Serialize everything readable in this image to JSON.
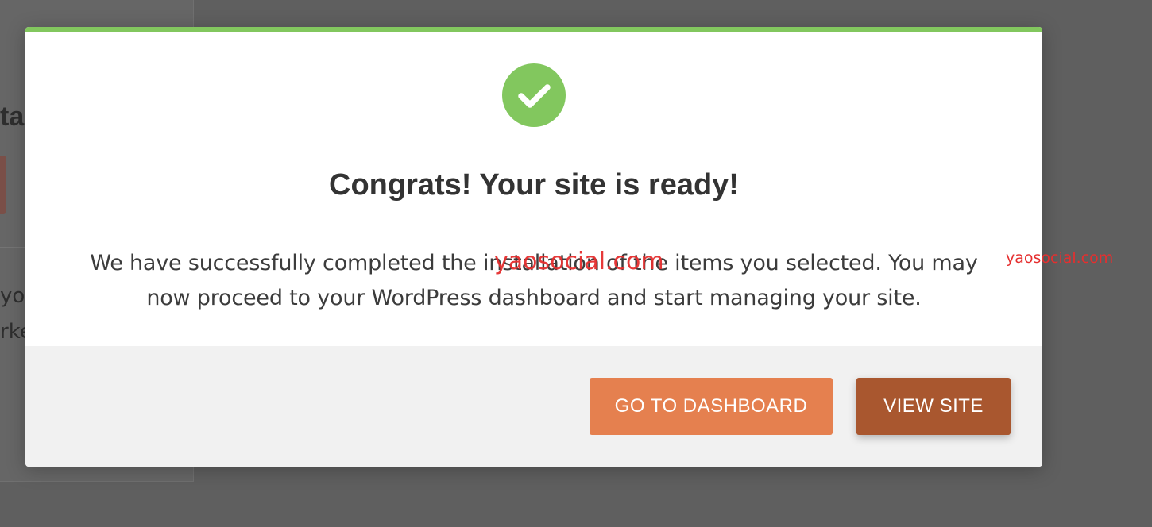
{
  "background_page": {
    "title_fragment": "ta",
    "text_line_1": "yo",
    "text_line_2": "rke"
  },
  "modal": {
    "accent_color": "#82c75e",
    "icon": "check-circle-icon",
    "title": "Congrats! Your site is ready!",
    "message": "We have successfully completed the installation of the items you selected. You may now proceed to your WordPress dashboard and start managing your site.",
    "buttons": {
      "dashboard_label": "GO TO DASHBOARD",
      "dashboard_color": "#e5804f",
      "view_site_label": "VIEW SITE",
      "view_site_color": "#a9572f"
    }
  },
  "watermarks": {
    "center": "yaosocial.com",
    "right": "yaosocial.com"
  }
}
